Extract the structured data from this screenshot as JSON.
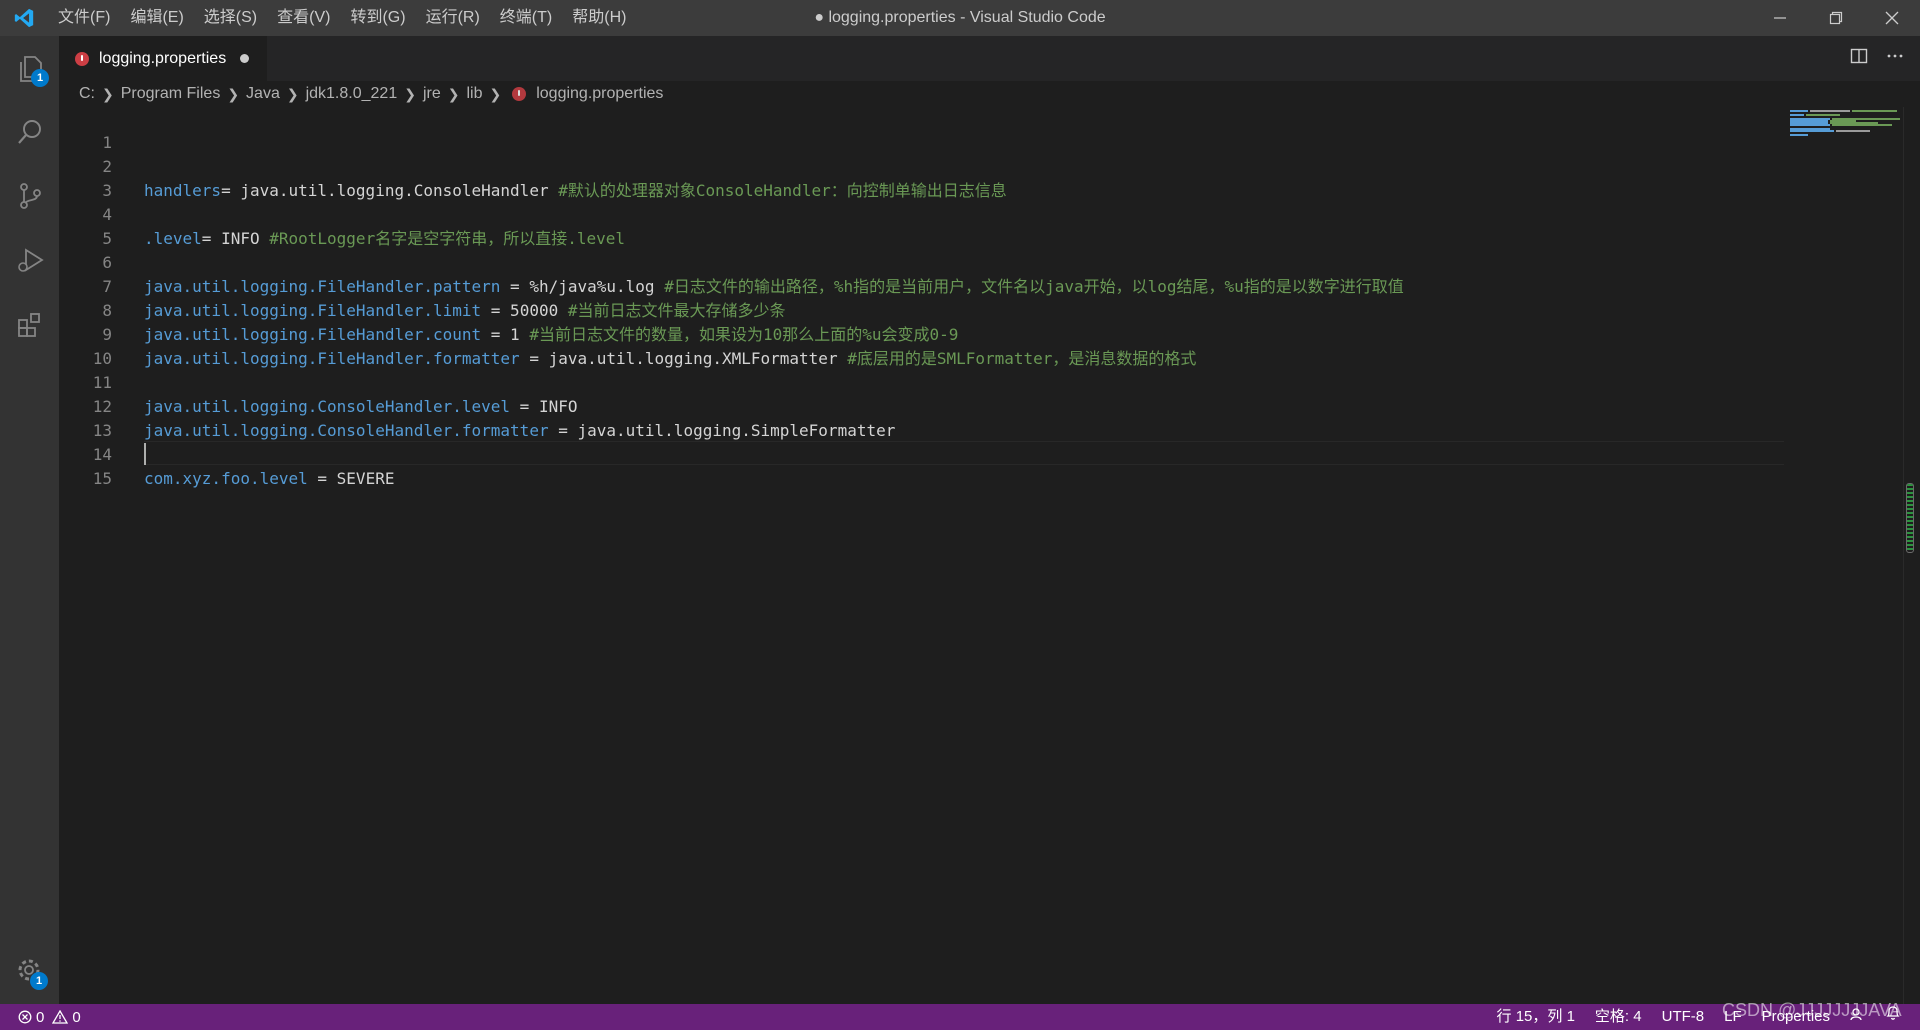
{
  "menu": [
    "文件(F)",
    "编辑(E)",
    "选择(S)",
    "查看(V)",
    "转到(G)",
    "运行(R)",
    "终端(T)",
    "帮助(H)"
  ],
  "window_title": "● logging.properties - Visual Studio Code",
  "tab": {
    "label": "logging.properties"
  },
  "breadcrumb": [
    "C:",
    "Program Files",
    "Java",
    "jdk1.8.0_221",
    "jre",
    "lib",
    "logging.properties"
  ],
  "activity": {
    "explorer_badge": "1",
    "settings_badge": "1"
  },
  "editor": {
    "lines": [
      {
        "num": "1",
        "key": "",
        "value": "",
        "comment": ""
      },
      {
        "num": "2",
        "key": "handlers",
        "value": "= java.util.logging.ConsoleHandler ",
        "comment": "#默认的处理器对象ConsoleHandler：向控制单输出日志信息"
      },
      {
        "num": "3",
        "key": "",
        "value": "",
        "comment": ""
      },
      {
        "num": "4",
        "key": ".level",
        "value": "= INFO ",
        "comment": "#RootLogger名字是空字符串，所以直接.level"
      },
      {
        "num": "5",
        "key": "",
        "value": "",
        "comment": ""
      },
      {
        "num": "6",
        "key": "java.util.logging.FileHandler.pattern",
        "value": " = %h/java%u.log ",
        "comment": "#日志文件的输出路径，%h指的是当前用户，文件名以java开始，以log结尾，%u指的是以数字进行取值"
      },
      {
        "num": "7",
        "key": "java.util.logging.FileHandler.limit",
        "value": " = 50000 ",
        "comment": "#当前日志文件最大存储多少条"
      },
      {
        "num": "8",
        "key": "java.util.logging.FileHandler.count",
        "value": " = 1 ",
        "comment": "#当前日志文件的数量，如果设为10那么上面的%u会变成0-9"
      },
      {
        "num": "9",
        "key": "java.util.logging.FileHandler.formatter",
        "value": " = java.util.logging.XMLFormatter ",
        "comment": "#底层用的是SMLFormatter，是消息数据的格式"
      },
      {
        "num": "10",
        "key": "",
        "value": "",
        "comment": ""
      },
      {
        "num": "11",
        "key": "java.util.logging.ConsoleHandler.level",
        "value": " = INFO",
        "comment": ""
      },
      {
        "num": "12",
        "key": "java.util.logging.ConsoleHandler.formatter",
        "value": " = java.util.logging.SimpleFormatter",
        "comment": ""
      },
      {
        "num": "13",
        "key": "",
        "value": "",
        "comment": ""
      },
      {
        "num": "14",
        "key": "com.xyz.foo.level",
        "value": " = SEVERE",
        "comment": ""
      },
      {
        "num": "15",
        "key": "",
        "value": "",
        "comment": ""
      }
    ]
  },
  "status": {
    "errors": "0",
    "warnings": "0",
    "position": "行 15，列 1",
    "spaces": "空格: 4",
    "encoding": "UTF-8",
    "eol": "LF",
    "language": "Properties"
  },
  "watermark": "CSDN @JJJJJJJJAVA",
  "colors": {
    "statusbar": "#68217a",
    "key": "#569cd6",
    "comment": "#6a9955",
    "file_icon": "#cc3e44"
  }
}
